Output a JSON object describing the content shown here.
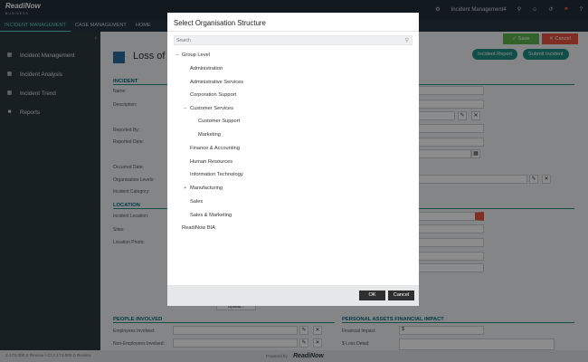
{
  "brand": {
    "name": "ReadiNow"
  },
  "topbar": {
    "user": "Incident Management4",
    "icons": [
      "settings-icon",
      "search-icon",
      "user-icon",
      "history-icon",
      "notification-icon",
      "help-icon"
    ]
  },
  "nav": {
    "items": [
      "INCIDENT MANAGEMENT",
      "CASE MANAGEMENT",
      "HOME"
    ]
  },
  "sidebar": {
    "items": [
      "Incident Management",
      "Incident Analysis",
      "Incident Trend",
      "Reports"
    ]
  },
  "page": {
    "title": "Loss of",
    "save": "Save",
    "cancel": "Cancel",
    "incident_report": "Incident Report",
    "submit_incident": "Submit Incident",
    "section_incident": "INCIDENT",
    "label_name": "Name:",
    "label_description": "Description:",
    "label_reported_by": "Reported By:",
    "label_reported_date": "Reported Date:",
    "label_occurred_date": "Occurred Date:",
    "label_org_levels": "Organisation Levels:",
    "label_incident_category": "Incident Category:",
    "section_location": "LOCATION",
    "label_incident_location": "Incident Location:",
    "label_sites": "Sites:",
    "label_location_photo": "Location Photo:",
    "section_people": "PEOPLE INVOLVED",
    "label_employees": "Employees Involved:",
    "label_non_employees": "Non-Employees Involved:",
    "section_assets": "PERSONAL ASSETS FINANCIAL IMPACT",
    "label_financial_impact": "Financial Impact:",
    "financial_value": "$",
    "label_loss_detail": "$ Loss Detail:",
    "upload": "Upload..."
  },
  "footer": {
    "version": "2.173.000.0 Review / Cl 2.173.000.0 Review",
    "powered": "Powered by",
    "brand": "ReadiNow"
  },
  "modal": {
    "title": "Select Organisation Structure",
    "search_placeholder": "Search",
    "ok": "OK",
    "cancel": "Cancel",
    "tree": [
      {
        "label": "Group Level",
        "toggle": "−"
      },
      {
        "label": "Administration",
        "toggle": ""
      },
      {
        "label": "Administrative Services",
        "toggle": ""
      },
      {
        "label": "Corporation Support",
        "toggle": ""
      },
      {
        "label": "Customer Services",
        "toggle": "−"
      },
      {
        "label": "Customer Support",
        "toggle": ""
      },
      {
        "label": "Marketing",
        "toggle": ""
      },
      {
        "label": "Finance & Accounting",
        "toggle": ""
      },
      {
        "label": "Human Resources",
        "toggle": ""
      },
      {
        "label": "Information Technology",
        "toggle": ""
      },
      {
        "label": "Manufacturing",
        "toggle": "+"
      },
      {
        "label": "Sales",
        "toggle": ""
      },
      {
        "label": "Sales & Marketing",
        "toggle": ""
      },
      {
        "label": "ReadiNow BIA",
        "toggle": ""
      }
    ]
  },
  "colors": {
    "accent": "#1e8f82",
    "nav_active": "#5fd3c7",
    "save": "#5db54c",
    "cancel": "#e9553f",
    "dark": "#22313a"
  }
}
